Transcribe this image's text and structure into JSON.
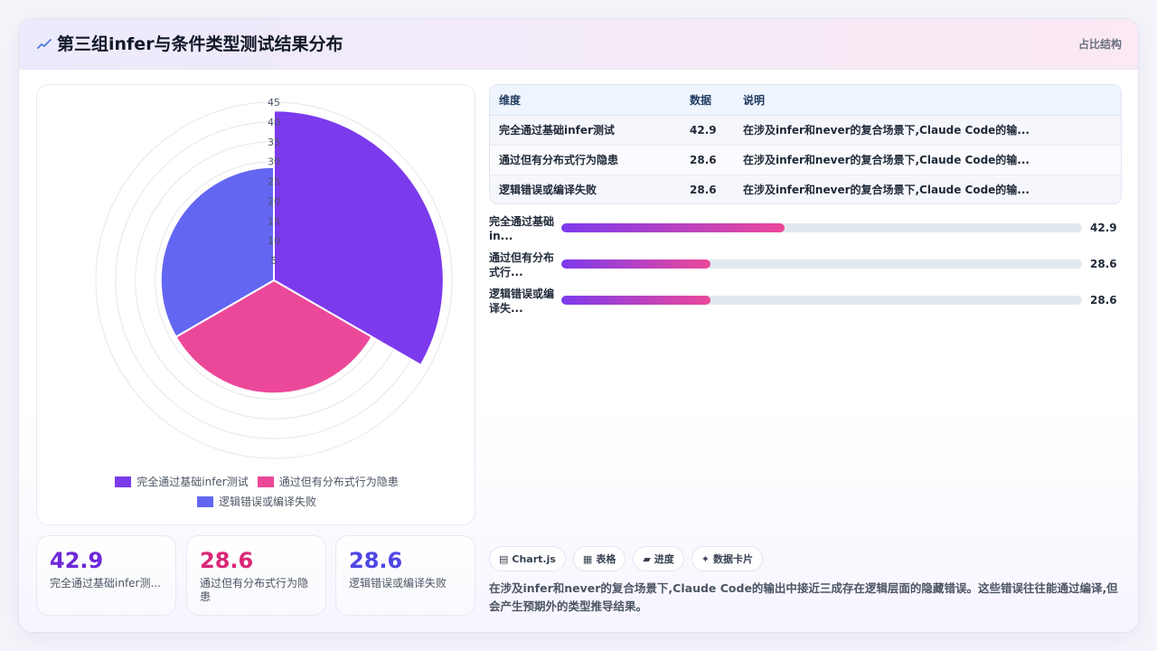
{
  "header": {
    "title": "第三组infer与条件类型测试结果分布",
    "tag": "占比结构"
  },
  "colors": {
    "purple": "#7c3aed",
    "pink": "#ec4899",
    "indigo": "#6366f1",
    "accent_purple": "#6d28d9",
    "accent_pink": "#db2777",
    "accent_indigo": "#4f46e5"
  },
  "chart_data": {
    "type": "polarArea",
    "categories": [
      "完全通过基础infer测试",
      "通过但有分布式行为隐患",
      "逻辑错误或编译失败"
    ],
    "values": [
      42.9,
      28.6,
      28.6
    ],
    "colors": [
      "#7c3aed",
      "#ec4899",
      "#6366f1"
    ],
    "rlim": [
      0,
      45
    ],
    "r_ticks": [
      5,
      10,
      15,
      20,
      25,
      30,
      35,
      40,
      45
    ],
    "r_tick_labels": [
      "5",
      "10",
      "15",
      "20",
      "25",
      "30",
      "35",
      "40",
      "45"
    ],
    "grid": true,
    "legend": "bottom"
  },
  "table": {
    "headers": [
      "维度",
      "数据",
      "说明"
    ],
    "rows": [
      {
        "name": "完全通过基础infer测试",
        "value": "42.9",
        "desc": "在涉及infer和never的复合场景下,Claude Code的输..."
      },
      {
        "name": "通过但有分布式行为隐患",
        "value": "28.6",
        "desc": "在涉及infer和never的复合场景下,Claude Code的输..."
      },
      {
        "name": "逻辑错误或编译失败",
        "value": "28.6",
        "desc": "在涉及infer和never的复合场景下,Claude Code的输..."
      }
    ]
  },
  "progress": [
    {
      "label_line1": "完全通过基础",
      "label_line2": "in...",
      "value": 42.9,
      "value_text": "42.9"
    },
    {
      "label_line1": "通过但有分布",
      "label_line2": "式行...",
      "value": 28.6,
      "value_text": "28.6"
    },
    {
      "label_line1": "逻辑错误或编",
      "label_line2": "译失...",
      "value": 28.6,
      "value_text": "28.6"
    }
  ],
  "progress_max": 100,
  "stats": [
    {
      "value": "42.9",
      "label": "完全通过基础infer测..."
    },
    {
      "value": "28.6",
      "label": "通过但有分布式行为隐患"
    },
    {
      "value": "28.6",
      "label": "逻辑错误或编译失败"
    }
  ],
  "chips": [
    {
      "icon": "▤",
      "label": "Chart.js"
    },
    {
      "icon": "▦",
      "label": "表格"
    },
    {
      "icon": "▰",
      "label": "进度"
    },
    {
      "icon": "✦",
      "label": "数据卡片"
    }
  ],
  "note": "在涉及infer和never的复合场景下,Claude Code的输出中接近三成存在逻辑层面的隐藏错误。这些错误往往能通过编译,但会产生预期外的类型推导结果。"
}
